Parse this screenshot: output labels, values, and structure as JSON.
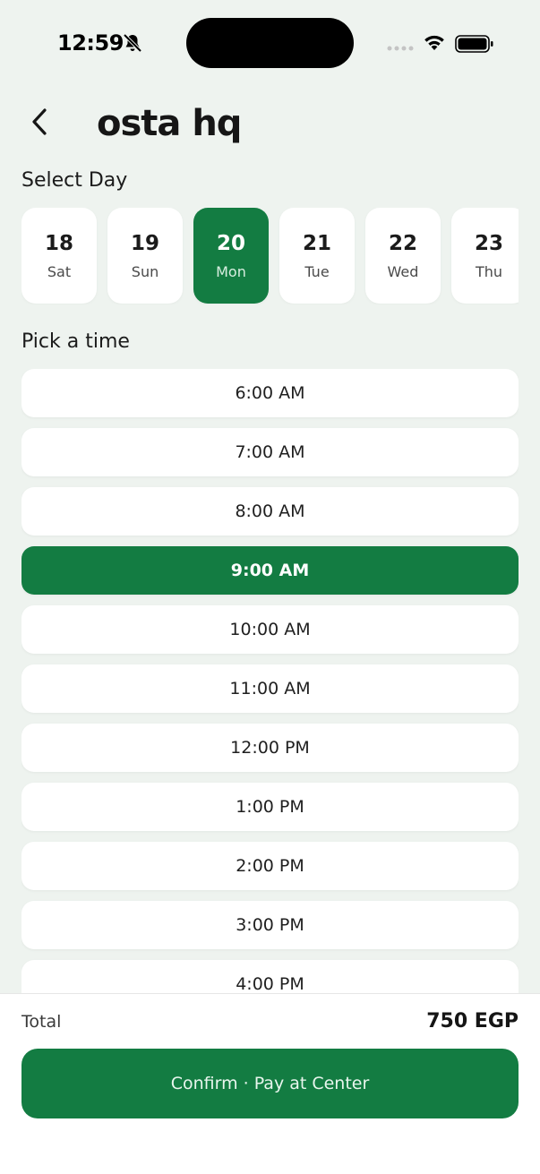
{
  "status_bar": {
    "time": "12:59",
    "icons": [
      "bell-muted-icon",
      "cellular-signal-icon",
      "wifi-icon",
      "battery-icon"
    ]
  },
  "header": {
    "back_icon": "chevron-left-icon",
    "title": "osta hq"
  },
  "day_section": {
    "title": "Select Day",
    "days": [
      {
        "num": "18",
        "name": "Sat",
        "selected": false
      },
      {
        "num": "19",
        "name": "Sun",
        "selected": false
      },
      {
        "num": "20",
        "name": "Mon",
        "selected": true
      },
      {
        "num": "21",
        "name": "Tue",
        "selected": false
      },
      {
        "num": "22",
        "name": "Wed",
        "selected": false
      },
      {
        "num": "23",
        "name": "Thu",
        "selected": false
      }
    ]
  },
  "time_section": {
    "title": "Pick a time",
    "slots": [
      {
        "label": "6:00 AM",
        "selected": false
      },
      {
        "label": "7:00 AM",
        "selected": false
      },
      {
        "label": "8:00 AM",
        "selected": false
      },
      {
        "label": "9:00 AM",
        "selected": true
      },
      {
        "label": "10:00 AM",
        "selected": false
      },
      {
        "label": "11:00 AM",
        "selected": false
      },
      {
        "label": "12:00 PM",
        "selected": false
      },
      {
        "label": "1:00 PM",
        "selected": false
      },
      {
        "label": "2:00 PM",
        "selected": false
      },
      {
        "label": "3:00 PM",
        "selected": false
      },
      {
        "label": "4:00 PM",
        "selected": false
      }
    ]
  },
  "footer": {
    "total_label": "Total",
    "total_value": "750 EGP",
    "confirm_label": "Confirm · Pay at Center"
  },
  "colors": {
    "accent": "#137c42",
    "background": "#eef3ef",
    "card": "#ffffff"
  }
}
